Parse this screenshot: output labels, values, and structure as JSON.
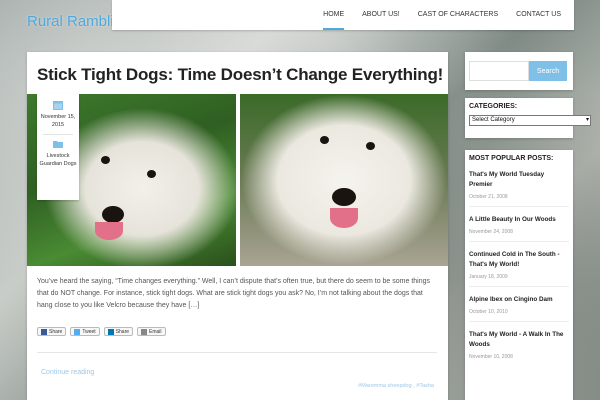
{
  "site": {
    "title": "Rural Ramblings"
  },
  "nav": {
    "items": [
      {
        "label": "HOME"
      },
      {
        "label": "ABOUT US!"
      },
      {
        "label": "CAST OF CHARACTERS"
      },
      {
        "label": "CONTACT US"
      }
    ],
    "active": "HOME"
  },
  "article": {
    "title": "Stick Tight Dogs: Time Doesn’t Change Everything!",
    "date": "November 15, 2015",
    "category": "Livestock Guardian Dogs",
    "excerpt": "You’ve heard the saying, “Time changes everything.” Well, I can’t dispute that’s often true, but there do seem to be some things that do NOT change. For instance, stick tight dogs. What are stick tight dogs you ask? No, I’m not talking about the dogs that hang close to you like Velcro because they have […]",
    "share": [
      {
        "label": "Share",
        "color": "#3b5998",
        "icon": "facebook-icon"
      },
      {
        "label": "Tweet",
        "color": "#55acee",
        "icon": "twitter-icon"
      },
      {
        "label": "Share",
        "color": "#0077b5",
        "icon": "linkedin-icon"
      },
      {
        "label": "Email",
        "color": "#888888",
        "icon": "email-icon"
      }
    ],
    "read_more": "Continue reading",
    "tags": "#Maremma sheepdog , #Tasha"
  },
  "sidebar": {
    "search": {
      "button": "Search",
      "placeholder": ""
    },
    "categories": {
      "title": "CATEGORIES:",
      "selected": "Select Category"
    },
    "popular": {
      "title": "MOST POPULAR POSTS:",
      "posts": [
        {
          "title": "That's My World Tuesday Premier",
          "date": "October 21, 2008"
        },
        {
          "title": "A Little Beauty In Our Woods",
          "date": "November 24, 2008"
        },
        {
          "title": "Continued Cold in The South - That's My World!",
          "date": "January 18, 2009"
        },
        {
          "title": "Alpine Ibex on Cingino Dam",
          "date": "October 10, 2010"
        },
        {
          "title": "That's My World - A Walk In The Woods",
          "date": "November 10, 2008"
        }
      ]
    }
  },
  "colors": {
    "accent": "#4ea9dd",
    "search_button": "#7ec0e8"
  }
}
